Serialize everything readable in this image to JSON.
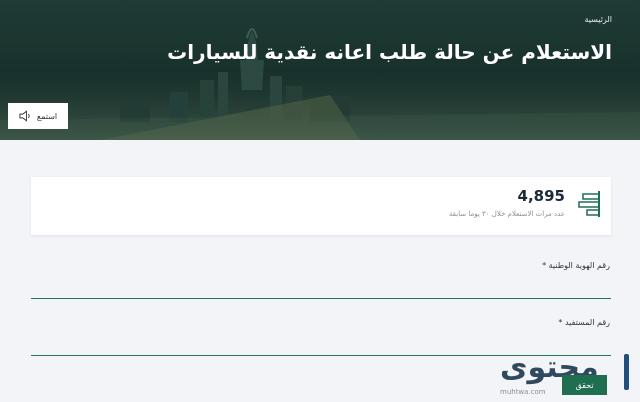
{
  "header": {
    "breadcrumb": "الرئيسية",
    "title": "الاستعلام عن حالة طلب اعانه نقدية للسيارات",
    "listen_label": "استمع"
  },
  "stats": {
    "value": "4,895",
    "subtitle": "عدد مرات الاستعلام خلال ٣٠ يوما سابقة"
  },
  "form": {
    "national_id_label": "رقم الهوية الوطنية *",
    "beneficiary_label": "رقم المستفيد *",
    "submit_label": "تحقق"
  },
  "watermark": {
    "logo_text": "محتوى",
    "site": "muhtwa.com"
  },
  "colors": {
    "hero": "#1f3b35",
    "accent": "#1f6e50",
    "field_line": "#22755a"
  }
}
